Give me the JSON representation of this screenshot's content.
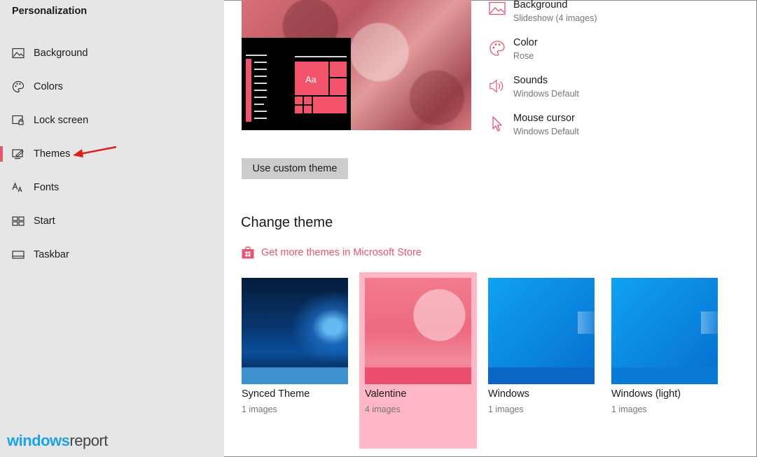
{
  "sidebar": {
    "title": "Personalization",
    "items": [
      {
        "label": "Background"
      },
      {
        "label": "Colors"
      },
      {
        "label": "Lock screen"
      },
      {
        "label": "Themes"
      },
      {
        "label": "Fonts"
      },
      {
        "label": "Start"
      },
      {
        "label": "Taskbar"
      }
    ],
    "selected": "Themes",
    "accent": "#e3566f"
  },
  "brand": {
    "part1": "windows",
    "part2": "report"
  },
  "attributes": [
    {
      "title": "Background",
      "sub": "Slideshow (4 images)",
      "icon": "image-icon"
    },
    {
      "title": "Color",
      "sub": "Rose",
      "icon": "palette-icon"
    },
    {
      "title": "Sounds",
      "sub": "Windows Default",
      "icon": "speaker-icon"
    },
    {
      "title": "Mouse cursor",
      "sub": "Windows Default",
      "icon": "cursor-icon"
    }
  ],
  "preview": {
    "tile_label": "Aa"
  },
  "custom_button": "Use custom theme",
  "change_theme": {
    "title": "Change theme",
    "store_link": "Get more themes in Microsoft Store",
    "themes": [
      {
        "name": "Synced Theme",
        "count": "1 images"
      },
      {
        "name": "Valentine",
        "count": "4 images"
      },
      {
        "name": "Windows",
        "count": "1 images"
      },
      {
        "name": "Windows (light)",
        "count": "1 images"
      }
    ],
    "selected": "Valentine",
    "selected_color": "#ffb7c6"
  }
}
